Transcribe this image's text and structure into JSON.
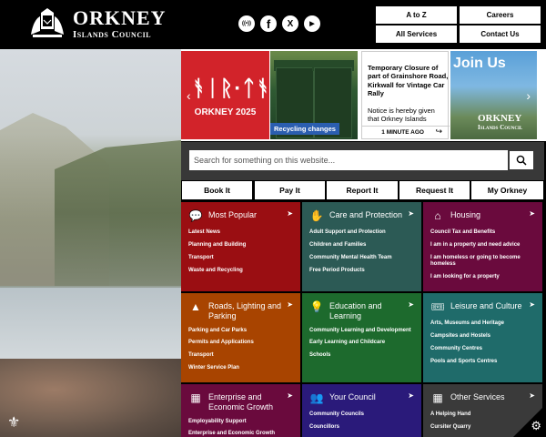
{
  "header": {
    "logo_title": "ORKNEY",
    "logo_subtitle": "Islands Council",
    "social": [
      {
        "icon": "podcast-icon",
        "glyph": "((•))"
      },
      {
        "icon": "facebook-icon",
        "glyph": "f"
      },
      {
        "icon": "x-icon",
        "glyph": "X"
      },
      {
        "icon": "youtube-icon",
        "glyph": "▶"
      }
    ],
    "buttons": {
      "atoz": "A to Z",
      "careers": "Careers",
      "all_services": "All Services",
      "contact": "Contact Us"
    }
  },
  "carousel": {
    "slide1": {
      "runes": "ᚬᛁᚱ·ᛏᚬ",
      "caption": "ORKNEY 2025"
    },
    "slide2": {
      "label": "Recycling changes"
    },
    "news": {
      "title": "Temporary Closure of part of Grainshore Road, Kirkwall for Vintage Car Rally",
      "body": "Notice is hereby given that Orkney Islands",
      "time": "1 MINUTE AGO"
    },
    "slide4": {
      "title": "Join Us",
      "logo_title": "ORKNEY",
      "logo_subtitle": "Islands Council"
    },
    "prev": "‹",
    "next": "›"
  },
  "search": {
    "placeholder": "Search for something on this website..."
  },
  "quick_links": [
    "Book It",
    "Pay It",
    "Report It",
    "Request It",
    "My Orkney"
  ],
  "tiles": [
    {
      "title": "Most Popular",
      "color": "#9a0e12",
      "icon": "chat-bubble-icon",
      "links": [
        "Latest News",
        "Planning and Building",
        "Transport",
        "Waste and Recycling"
      ]
    },
    {
      "title": "Care and Protection",
      "color": "#2c5a55",
      "icon": "care-hands-icon",
      "links": [
        "Adult Support and Protection",
        "Children and Families",
        "Community Mental Health Team",
        "Free Period Products"
      ]
    },
    {
      "title": "Housing",
      "color": "#6a0a3d",
      "icon": "house-icon",
      "links": [
        "Council Tax and Benefits",
        "I am in a property and need advice",
        "I am homeless or going to become homeless",
        "I am looking for a property"
      ]
    },
    {
      "title": "Roads, Lighting and Parking",
      "color": "#a84400",
      "icon": "traffic-cone-icon",
      "links": [
        "Parking and Car Parks",
        "Permits and Applications",
        "Transport",
        "Winter Service Plan"
      ]
    },
    {
      "title": "Education and Learning",
      "color": "#1d6a2d",
      "icon": "head-lightbulb-icon",
      "links": [
        "Community Learning and Development",
        "Early Learning and Childcare",
        "Schools"
      ]
    },
    {
      "title": "Leisure and Culture",
      "color": "#1f6b6a",
      "icon": "ticket-icon",
      "links": [
        "Arts, Museums and Heritage",
        "Campsites and Hostels",
        "Community Centres",
        "Pools and Sports Centres"
      ]
    },
    {
      "title": "Enterprise and Economic Growth",
      "color": "#6a0a3d",
      "icon": "business-icon",
      "links": [
        "Employability Support",
        "Enterprise and Economic Growth"
      ]
    },
    {
      "title": "Your Council",
      "color": "#2a1a7a",
      "icon": "people-icon",
      "links": [
        "Community Councils",
        "Councillors"
      ]
    },
    {
      "title": "Other Services",
      "color": "#3a3a3a",
      "icon": "grid-icon",
      "links": [
        "A Helping Hand",
        "Cursiter Quarry"
      ]
    }
  ],
  "settings": {
    "icon": "gear-icon"
  }
}
